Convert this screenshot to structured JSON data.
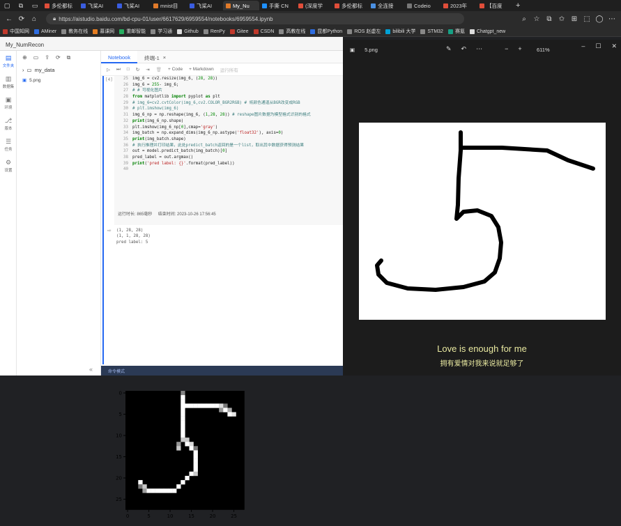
{
  "browser": {
    "tabs": [
      {
        "label": "多伦都标",
        "color": "#e04e3a"
      },
      {
        "label": "飞桨AI",
        "color": "#3a5de0"
      },
      {
        "label": "飞桨AI",
        "color": "#3a5de0"
      },
      {
        "label": "mnist目",
        "color": "#e07a2a"
      },
      {
        "label": "飞桨AI",
        "color": "#3a5de0"
      },
      {
        "label": "My_Nu",
        "color": "#e07a2a"
      },
      {
        "label": "手撕 CN",
        "color": "#1e90ff"
      },
      {
        "label": "(深度学",
        "color": "#e04e3a"
      },
      {
        "label": "多伦都标",
        "color": "#e04e3a"
      },
      {
        "label": "全连接 ",
        "color": "#4a90e2"
      },
      {
        "label": "Codeio",
        "color": "#777777"
      },
      {
        "label": "2023年",
        "color": "#e04e3a"
      },
      {
        "label": "【百度",
        "color": "#e04e3a"
      }
    ],
    "new_tab": "+",
    "url": "https://aistudio.baidu.com/bd-cpu-01/user/6617629/6959554/notebooks/6959554.ipynb",
    "bookmarks": [
      {
        "label": "中国知网",
        "color": "#c0392b"
      },
      {
        "label": "AMiner",
        "color": "#2d6cdf"
      },
      {
        "label": "教务在线",
        "color": "#888888"
      },
      {
        "label": "慕课网",
        "color": "#e67e22"
      },
      {
        "label": "重邮智能",
        "color": "#27ae60"
      },
      {
        "label": "学习通",
        "color": "#888888"
      },
      {
        "label": "Github",
        "color": "#dddddd"
      },
      {
        "label": "RenPy",
        "color": "#888888"
      },
      {
        "label": "Gitee",
        "color": "#c0392b"
      },
      {
        "label": "CSDN",
        "color": "#c0392b"
      },
      {
        "label": "高教在线",
        "color": "#888888"
      },
      {
        "label": "昆都Python",
        "color": "#2d6cdf"
      },
      {
        "label": "ROS 赵虚左",
        "color": "#888888"
      },
      {
        "label": "bilibili 大学",
        "color": "#00a1d6"
      },
      {
        "label": "STM32",
        "color": "#888888"
      },
      {
        "label": "赛氪",
        "color": "#16a085"
      },
      {
        "label": "Chatgpt_new",
        "color": "#dddddd"
      }
    ]
  },
  "notebook": {
    "title": "My_NumRecon",
    "nav": [
      {
        "label": "文件夹",
        "icon": "▤"
      },
      {
        "label": "数据集",
        "icon": "▥"
      },
      {
        "label": "环境",
        "icon": "▣"
      },
      {
        "label": "版本",
        "icon": "⎇"
      },
      {
        "label": "任务",
        "icon": "☰"
      },
      {
        "label": "设置",
        "icon": "⚙"
      }
    ],
    "folder": "my_data",
    "file": "5.png",
    "tabs": [
      {
        "label": "Notebook"
      },
      {
        "label": "终端-1",
        "close": "×"
      }
    ],
    "toolbar": {
      "code": "+ Code",
      "markdown": "+ Markdown",
      "run_hint": "运行所有"
    },
    "cell_prompt": "[4]",
    "code": [
      {
        "n": "25",
        "segs": [
          {
            "t": "img_6 = cv2.resize(img_6, (",
            "c": ""
          },
          {
            "t": "28",
            "c": "nu"
          },
          {
            "t": ", ",
            "c": ""
          },
          {
            "t": "28",
            "c": "nu"
          },
          {
            "t": "))",
            "c": ""
          }
        ]
      },
      {
        "n": "26",
        "segs": [
          {
            "t": "img_6 = ",
            "c": ""
          },
          {
            "t": "255",
            "c": "nu"
          },
          {
            "t": "- img_6;",
            "c": ""
          }
        ]
      },
      {
        "n": "27",
        "segs": [
          {
            "t": "# # 可视化图片",
            "c": "cm"
          }
        ]
      },
      {
        "n": "28",
        "segs": [
          {
            "t": "from",
            "c": "kw"
          },
          {
            "t": " matplotlib ",
            "c": ""
          },
          {
            "t": "import",
            "c": "kw"
          },
          {
            "t": " pyplot ",
            "c": ""
          },
          {
            "t": "as",
            "c": "kw"
          },
          {
            "t": " plt",
            "c": ""
          }
        ]
      },
      {
        "n": "29",
        "segs": [
          {
            "t": "# img_6=cv2.cvtColor(img_6,cv2.COLOR_BGR2RGB) # 将颜色通道从BGR改变成RGB",
            "c": "cm"
          }
        ]
      },
      {
        "n": "30",
        "segs": [
          {
            "t": "# plt.imshow(img_6)",
            "c": "cm"
          }
        ]
      },
      {
        "n": "31",
        "segs": [
          {
            "t": "img_6_np = np.reshape(img_6, (",
            "c": ""
          },
          {
            "t": "1",
            "c": "nu"
          },
          {
            "t": ",",
            "c": ""
          },
          {
            "t": "28",
            "c": "nu"
          },
          {
            "t": ", ",
            "c": ""
          },
          {
            "t": "28",
            "c": "nu"
          },
          {
            "t": ")) ",
            "c": ""
          },
          {
            "t": "# reshape图片数据为模型格式识别的格式",
            "c": "cm"
          }
        ]
      },
      {
        "n": "32",
        "segs": [
          {
            "t": "print",
            "c": "kw"
          },
          {
            "t": "(img_6_np.shape)",
            "c": ""
          }
        ]
      },
      {
        "n": "33",
        "segs": [
          {
            "t": "plt.imshow(img_6_np[",
            "c": ""
          },
          {
            "t": "0",
            "c": "nu"
          },
          {
            "t": "],cmap=",
            "c": ""
          },
          {
            "t": "'gray'",
            "c": "st"
          },
          {
            "t": ")",
            "c": ""
          }
        ]
      },
      {
        "n": "34",
        "segs": [
          {
            "t": "img_batch = np.expand_dims(img_6_np.astype(",
            "c": ""
          },
          {
            "t": "'float32'",
            "c": "st"
          },
          {
            "t": "), axis=",
            "c": ""
          },
          {
            "t": "0",
            "c": "nu"
          },
          {
            "t": ")",
            "c": ""
          }
        ]
      },
      {
        "n": "35",
        "segs": [
          {
            "t": "print",
            "c": "kw"
          },
          {
            "t": "(img_batch.shape)",
            "c": ""
          }
        ]
      },
      {
        "n": "36",
        "segs": [
          {
            "t": "# 执行推理并打印结果，此处predict_batch返回的是一个list，取出其中数据获得预测结果",
            "c": "cm"
          }
        ]
      },
      {
        "n": "37",
        "segs": [
          {
            "t": "out = model.predict_batch(img_batch)[",
            "c": ""
          },
          {
            "t": "0",
            "c": "nu"
          },
          {
            "t": "]",
            "c": ""
          }
        ]
      },
      {
        "n": "38",
        "segs": [
          {
            "t": "pred_label = out.argmax()",
            "c": ""
          }
        ]
      },
      {
        "n": "39",
        "segs": [
          {
            "t": "print",
            "c": "kw"
          },
          {
            "t": "(",
            "c": ""
          },
          {
            "t": "'pred label: {}'",
            "c": "st"
          },
          {
            "t": ".format(pred_label))",
            "c": ""
          }
        ]
      },
      {
        "n": "40",
        "segs": [
          {
            "t": "",
            "c": ""
          }
        ]
      }
    ],
    "run_time_label": "运行时长: 865毫秒",
    "end_time_label": "结束时间: 2023-10-26 17:56:45",
    "output_prompt": "⇨",
    "output_lines": [
      "(1, 28, 28)",
      "(1, 1, 28, 28)",
      "pred label: 5"
    ],
    "status": "命令模式"
  },
  "chart_data": {
    "type": "heatmap",
    "title": "",
    "x_ticks": [
      0,
      5,
      10,
      15,
      20,
      25
    ],
    "y_ticks": [
      0,
      5,
      10,
      15,
      20,
      25
    ],
    "xlim": [
      -0.5,
      27.5
    ],
    "ylim": [
      27.5,
      -0.5
    ],
    "cmap": "gray",
    "pixels": [
      {
        "r": 0,
        "c": 13,
        "v": 130
      },
      {
        "r": 1,
        "c": 13,
        "v": 255
      },
      {
        "r": 2,
        "c": 13,
        "v": 255
      },
      {
        "r": 3,
        "c": 13,
        "v": 255
      },
      {
        "r": 3,
        "c": 14,
        "v": 255
      },
      {
        "r": 3,
        "c": 15,
        "v": 255
      },
      {
        "r": 3,
        "c": 16,
        "v": 255
      },
      {
        "r": 3,
        "c": 17,
        "v": 255
      },
      {
        "r": 3,
        "c": 18,
        "v": 255
      },
      {
        "r": 3,
        "c": 19,
        "v": 255
      },
      {
        "r": 3,
        "c": 20,
        "v": 255
      },
      {
        "r": 3,
        "c": 21,
        "v": 255
      },
      {
        "r": 3,
        "c": 22,
        "v": 220
      },
      {
        "r": 3,
        "c": 23,
        "v": 120
      },
      {
        "r": 4,
        "c": 13,
        "v": 255
      },
      {
        "r": 4,
        "c": 22,
        "v": 150
      },
      {
        "r": 4,
        "c": 23,
        "v": 255
      },
      {
        "r": 4,
        "c": 24,
        "v": 170
      },
      {
        "r": 5,
        "c": 13,
        "v": 255
      },
      {
        "r": 5,
        "c": 24,
        "v": 255
      },
      {
        "r": 5,
        "c": 25,
        "v": 230
      },
      {
        "r": 6,
        "c": 13,
        "v": 255
      },
      {
        "r": 7,
        "c": 13,
        "v": 255
      },
      {
        "r": 8,
        "c": 13,
        "v": 255
      },
      {
        "r": 9,
        "c": 13,
        "v": 255
      },
      {
        "r": 10,
        "c": 13,
        "v": 255
      },
      {
        "r": 11,
        "c": 13,
        "v": 200
      },
      {
        "r": 11,
        "c": 14,
        "v": 200
      },
      {
        "r": 12,
        "c": 12,
        "v": 150
      },
      {
        "r": 12,
        "c": 14,
        "v": 255
      },
      {
        "r": 12,
        "c": 15,
        "v": 220
      },
      {
        "r": 13,
        "c": 12,
        "v": 200
      },
      {
        "r": 13,
        "c": 15,
        "v": 255
      },
      {
        "r": 13,
        "c": 16,
        "v": 120
      },
      {
        "r": 14,
        "c": 16,
        "v": 255
      },
      {
        "r": 15,
        "c": 16,
        "v": 255
      },
      {
        "r": 16,
        "c": 16,
        "v": 255
      },
      {
        "r": 17,
        "c": 16,
        "v": 255
      },
      {
        "r": 18,
        "c": 16,
        "v": 255
      },
      {
        "r": 19,
        "c": 15,
        "v": 255
      },
      {
        "r": 19,
        "c": 16,
        "v": 200
      },
      {
        "r": 20,
        "c": 14,
        "v": 255
      },
      {
        "r": 21,
        "c": 3,
        "v": 255
      },
      {
        "r": 21,
        "c": 13,
        "v": 255
      },
      {
        "r": 22,
        "c": 3,
        "v": 120
      },
      {
        "r": 22,
        "c": 4,
        "v": 200
      },
      {
        "r": 22,
        "c": 12,
        "v": 255
      },
      {
        "r": 23,
        "c": 4,
        "v": 160
      },
      {
        "r": 23,
        "c": 5,
        "v": 255
      },
      {
        "r": 23,
        "c": 6,
        "v": 255
      },
      {
        "r": 23,
        "c": 7,
        "v": 255
      },
      {
        "r": 23,
        "c": 8,
        "v": 255
      },
      {
        "r": 23,
        "c": 9,
        "v": 255
      },
      {
        "r": 23,
        "c": 10,
        "v": 255
      },
      {
        "r": 23,
        "c": 11,
        "v": 255
      }
    ]
  },
  "viewer": {
    "title": "5.png",
    "zoom": "611%",
    "tool_icons": [
      "✎",
      "↶",
      "⋯",
      "−",
      "+"
    ],
    "window_controls": [
      "–",
      "☐",
      "✕"
    ],
    "subtitle_en": "Love is enough for me",
    "subtitle_cn": "拥有爱情对我来说就足够了"
  }
}
